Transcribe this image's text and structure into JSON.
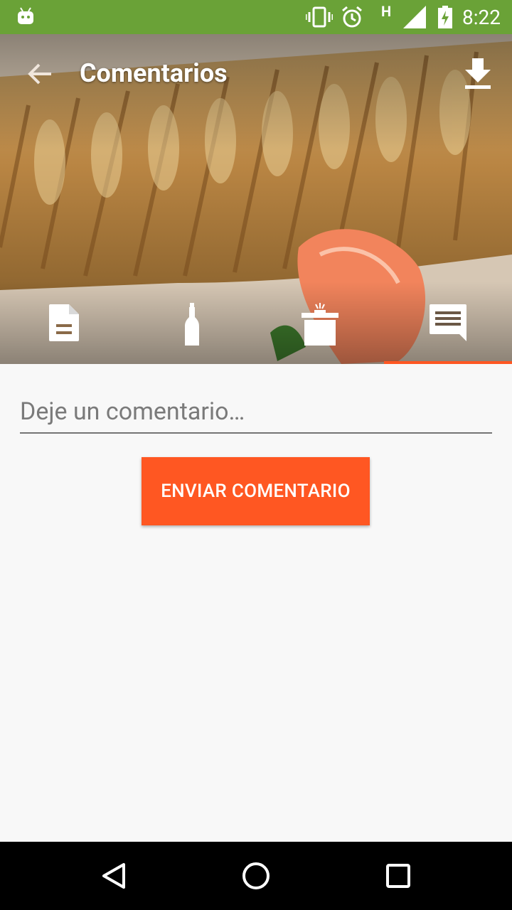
{
  "status_bar": {
    "time": "8:22",
    "network_type": "H",
    "icons": [
      "android-icon",
      "vibrate-icon",
      "alarm-icon",
      "signal-icon",
      "battery-charging-icon"
    ]
  },
  "app_bar": {
    "title": "Comentarios",
    "back_icon": "arrow-back-icon",
    "action_icon": "download-icon"
  },
  "tabs": [
    {
      "icon": "document-icon",
      "selected": false
    },
    {
      "icon": "bottle-icon",
      "selected": false
    },
    {
      "icon": "cooking-pot-icon",
      "selected": false
    },
    {
      "icon": "comment-icon",
      "selected": true
    }
  ],
  "comment": {
    "placeholder": "Deje un comentario…",
    "value": ""
  },
  "send_button_label": "ENVIAR COMENTARIO",
  "colors": {
    "status_bar": "#6aa237",
    "accent": "#ff5722",
    "background": "#f8f8f8"
  },
  "nav_bar": {
    "icons": [
      "back-triangle-icon",
      "home-circle-icon",
      "recents-square-icon"
    ]
  }
}
